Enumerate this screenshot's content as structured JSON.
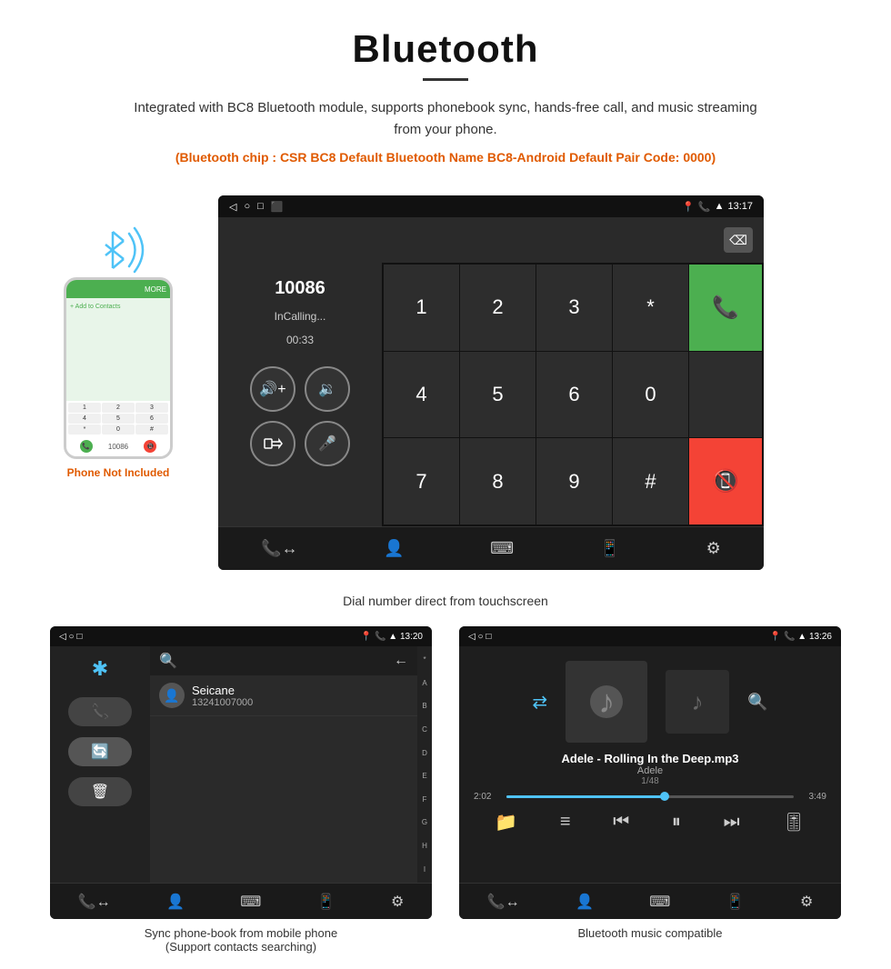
{
  "header": {
    "title": "Bluetooth",
    "description": "Integrated with BC8 Bluetooth module, supports phonebook sync, hands-free call, and music streaming from your phone.",
    "specs": "(Bluetooth chip : CSR BC8    Default Bluetooth Name BC8-Android    Default Pair Code: 0000)"
  },
  "phone": {
    "not_included": "Phone Not Included"
  },
  "call_screen": {
    "number": "10086",
    "status": "InCalling...",
    "timer": "00:33",
    "time": "13:17",
    "caption": "Dial number direct from touchscreen"
  },
  "phonebook_screen": {
    "time": "13:20",
    "contact_name": "Seicane",
    "contact_number": "13241007000",
    "caption_line1": "Sync phone-book from mobile phone",
    "caption_line2": "(Support contacts searching)"
  },
  "music_screen": {
    "time": "13:26",
    "track_name": "Adele - Rolling In the Deep.mp3",
    "artist": "Adele",
    "track_position": "1/48",
    "current_time": "2:02",
    "total_time": "3:49",
    "caption": "Bluetooth music compatible"
  },
  "keypad": {
    "keys": [
      "1",
      "2",
      "3",
      "*",
      "4",
      "5",
      "6",
      "0",
      "7",
      "8",
      "9",
      "#"
    ]
  },
  "alphabet": [
    "*",
    "A",
    "B",
    "C",
    "D",
    "E",
    "F",
    "G",
    "H",
    "I"
  ]
}
